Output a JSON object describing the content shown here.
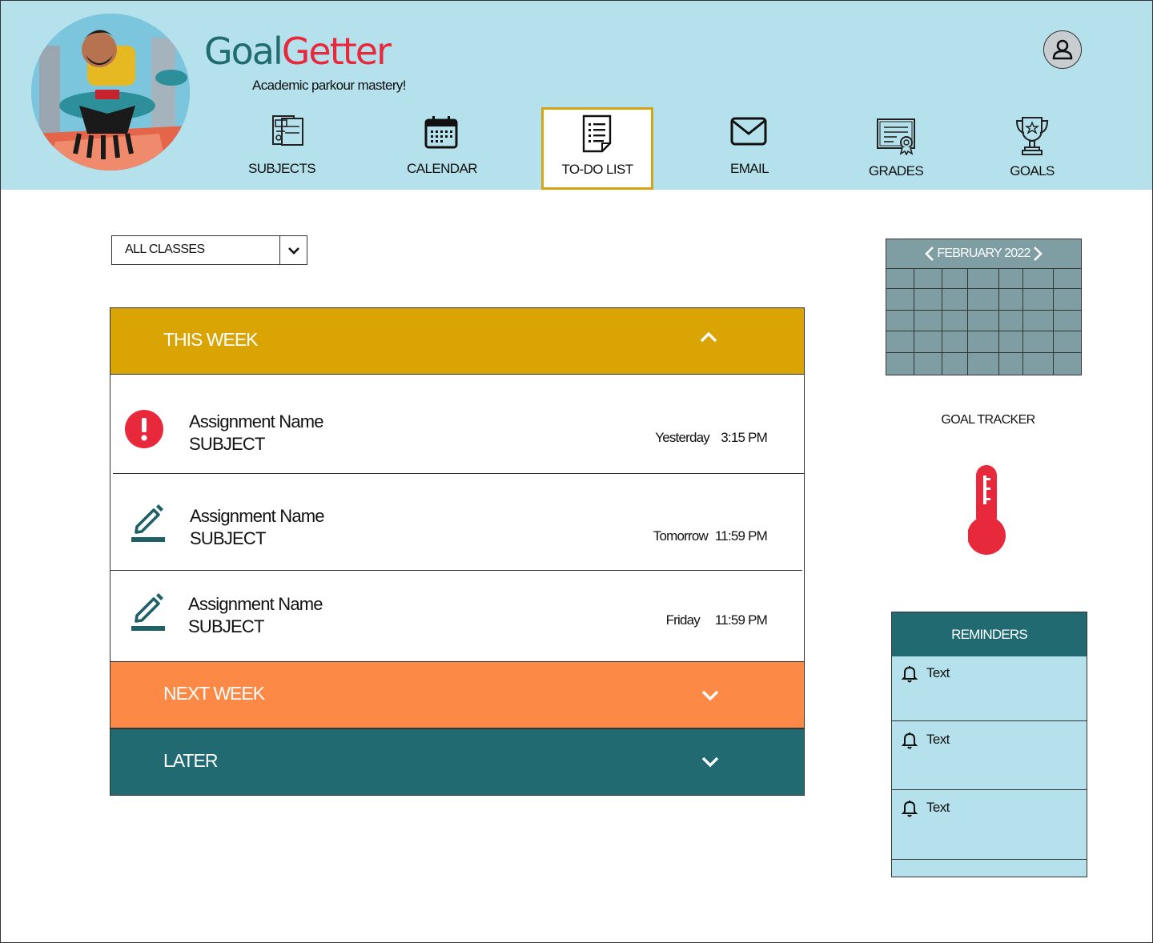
{
  "app": {
    "brand_part1": "Goal",
    "brand_part2": "Getter",
    "tagline": "Academic parkour mastery!"
  },
  "nav": {
    "items": [
      {
        "label": "SUBJECTS",
        "icon": "subjects-icon"
      },
      {
        "label": "CALENDAR",
        "icon": "calendar-icon"
      },
      {
        "label": "TO-DO LIST",
        "icon": "todo-list-icon",
        "active": true
      },
      {
        "label": "EMAIL",
        "icon": "email-icon"
      },
      {
        "label": "GRADES",
        "icon": "grades-icon"
      },
      {
        "label": "GOALS",
        "icon": "trophy-icon"
      }
    ]
  },
  "filter": {
    "selected": "ALL CLASSES"
  },
  "sections": {
    "this_week": {
      "title": "THIS WEEK",
      "color": "#d9a404",
      "expanded": true
    },
    "next_week": {
      "title": "NEXT WEEK",
      "color": "#fd8947",
      "expanded": false
    },
    "later": {
      "title": "LATER",
      "color": "#216a71",
      "expanded": false
    }
  },
  "assignments": [
    {
      "name": "Assignment Name",
      "subject": "SUBJECT",
      "day": "Yesterday",
      "time": "3:15 PM",
      "status_icon": "overdue-alert-icon"
    },
    {
      "name": "Assignment Name",
      "subject": "SUBJECT",
      "day": "Tomorrow",
      "time": "11:59 PM",
      "status_icon": "edit-pencil-icon"
    },
    {
      "name": "Assignment Name",
      "subject": "SUBJECT",
      "day": "Friday",
      "time": "11:59 PM",
      "status_icon": "edit-pencil-icon"
    }
  ],
  "calendar": {
    "month": "FEBRUARY 2022",
    "color": "#7f9ea3"
  },
  "goal_tracker": {
    "title": "GOAL TRACKER",
    "color": "#e8283b"
  },
  "reminders": {
    "title": "REMINDERS",
    "items": [
      {
        "text": "Text"
      },
      {
        "text": "Text"
      },
      {
        "text": "Text"
      }
    ]
  },
  "colors": {
    "header_bg": "#b4e1ec",
    "accent_teal": "#216a71",
    "active_border": "#d4a414",
    "alert_red": "#e8283b"
  }
}
